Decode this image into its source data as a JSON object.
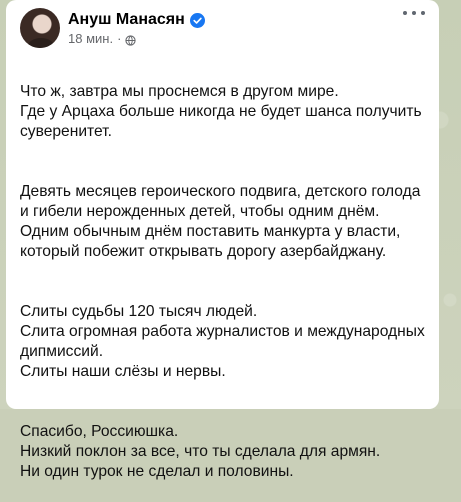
{
  "post": {
    "author_name": "Ануш Манасян",
    "timestamp": "18 мин.",
    "separator": "·",
    "paragraphs": [
      "Что ж, завтра мы проснемся в другом мире.\nГде у Арцаха больше никогда не будет шанса получить суверенитет.",
      "Девять месяцев героического подвига, детского голода и гибели нерожденных детей, чтобы одним днём.\nОдним обычным днём поставить манкурта у власти, который побежит открывать дорогу азербайджану.",
      "Слиты судьбы 120 тысяч людей.\nСлита огромная работа журналистов и международных дипмиссий.\nСлиты наши слёзы и нервы.",
      "Спасибо, Россиюшка.\nНизкий поклон за все, что ты сделала для армян.\nНи один турок не сделал и половины."
    ]
  },
  "icons": {
    "verified": "verified-badge-icon",
    "audience": "globe-icon",
    "more": "more-options-icon"
  },
  "colors": {
    "verified_blue": "#1877f2",
    "secondary_text": "#65676b",
    "background": "#c9cfb8"
  }
}
